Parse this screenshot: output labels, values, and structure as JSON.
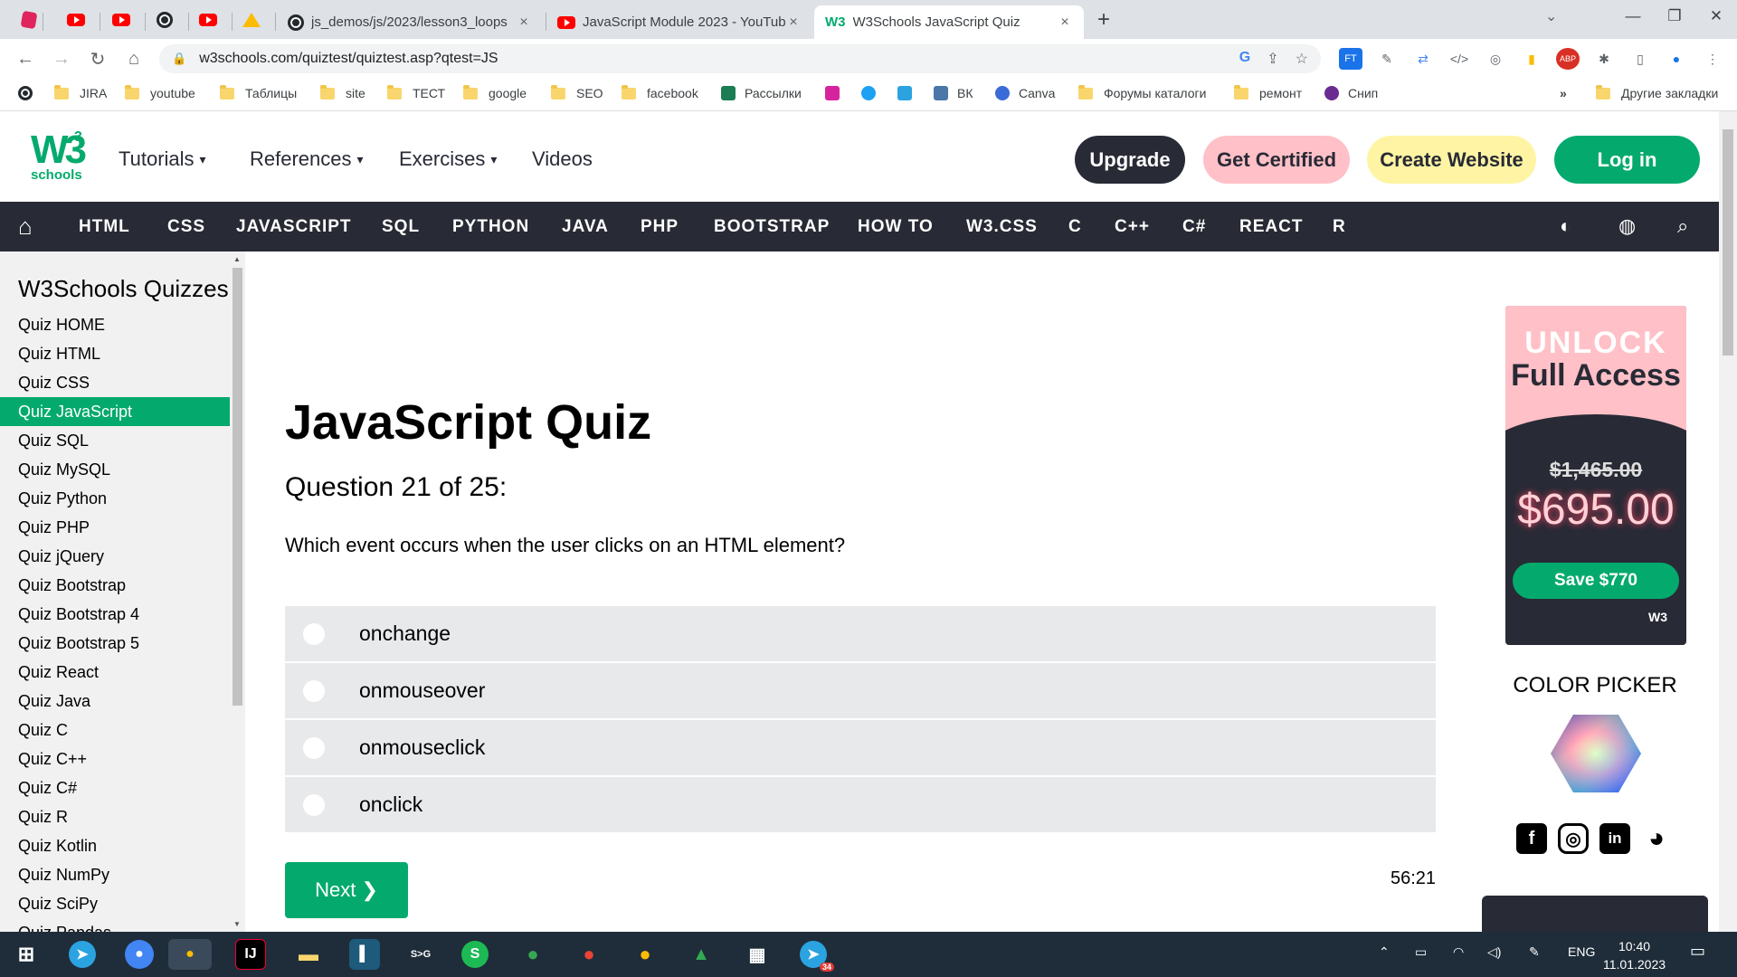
{
  "browser": {
    "tabs": [
      {
        "title": "js_demos/js/2023/lesson3_loops",
        "icon": "github-icon"
      },
      {
        "title": "JavaScript Module 2023 - YouTub",
        "icon": "youtube-icon"
      },
      {
        "title": "W3Schools JavaScript Quiz",
        "icon": "w3schools-icon",
        "favicon_text": "W3"
      }
    ],
    "close_glyph": "×",
    "new_tab_glyph": "+",
    "url": "w3schools.com/quiztest/quiztest.asp?qtest=JS",
    "bookmarks": [
      {
        "label": "JIRA",
        "type": "folder"
      },
      {
        "label": "youtube",
        "type": "folder"
      },
      {
        "label": "Таблицы",
        "type": "folder"
      },
      {
        "label": "site",
        "type": "folder"
      },
      {
        "label": "ТЕСТ",
        "type": "folder"
      },
      {
        "label": "google",
        "type": "folder"
      },
      {
        "label": "SEO",
        "type": "folder"
      },
      {
        "label": "facebook",
        "type": "folder"
      },
      {
        "label": "Рассылки",
        "type": "link"
      },
      {
        "label": "ВК",
        "type": "link"
      },
      {
        "label": "Canva",
        "type": "link"
      },
      {
        "label": "Форумы каталоги",
        "type": "folder"
      },
      {
        "label": "ремонт",
        "type": "folder"
      },
      {
        "label": "Снип",
        "type": "link"
      },
      {
        "label": "Другие закладки",
        "type": "folder"
      }
    ],
    "more_bookmarks": "»"
  },
  "header": {
    "logo_text": "W3",
    "logo_sup": "3",
    "logo_sub": "schools",
    "menu": [
      "Tutorials",
      "References",
      "Exercises",
      "Videos"
    ],
    "caret": "▾",
    "upgrade": "Upgrade",
    "get_certified": "Get Certified",
    "create_website": "Create Website",
    "login": "Log in"
  },
  "topics": [
    "HTML",
    "CSS",
    "JAVASCRIPT",
    "SQL",
    "PYTHON",
    "JAVA",
    "PHP",
    "BOOTSTRAP",
    "HOW TO",
    "W3.CSS",
    "C",
    "C++",
    "C#",
    "REACT",
    "R"
  ],
  "sidebar": {
    "title": "W3Schools Quizzes",
    "items": [
      "Quiz HOME",
      "Quiz HTML",
      "Quiz CSS",
      "Quiz JavaScript",
      "Quiz SQL",
      "Quiz MySQL",
      "Quiz Python",
      "Quiz PHP",
      "Quiz jQuery",
      "Quiz Bootstrap",
      "Quiz Bootstrap 4",
      "Quiz Bootstrap 5",
      "Quiz React",
      "Quiz Java",
      "Quiz C",
      "Quiz C++",
      "Quiz C#",
      "Quiz R",
      "Quiz Kotlin",
      "Quiz NumPy",
      "Quiz SciPy",
      "Quiz Pandas"
    ],
    "active_index": 3
  },
  "quiz": {
    "title": "JavaScript Quiz",
    "question_number": "Question 21 of 25:",
    "question": "Which event occurs when the user clicks on an HTML element?",
    "answers": [
      "onchange",
      "onmouseover",
      "onmouseclick",
      "onclick"
    ],
    "next": "Next ❯",
    "timer": "56:21"
  },
  "ad": {
    "unlock": "UNLOCK",
    "full_access": "Full Access",
    "old_price": "$1,465.00",
    "new_price": "$695.00",
    "save": "Save $770",
    "logo": "W3"
  },
  "right": {
    "color_picker": "COLOR PICKER",
    "socials": [
      {
        "icon": "facebook-icon",
        "glyph": "f"
      },
      {
        "icon": "instagram-icon",
        "glyph": "◎"
      },
      {
        "icon": "linkedin-icon",
        "glyph": "in"
      },
      {
        "icon": "discord-icon",
        "glyph": "◕"
      }
    ]
  },
  "taskbar": {
    "language": "ENG",
    "time": "10:40",
    "date": "11.01.2023",
    "telegram_badge": "34"
  },
  "colors": {
    "accent_green": "#04aa6d",
    "dark_nav": "#282a35",
    "certified_pink": "#ffc0c7",
    "create_yellow": "#fff4a3"
  }
}
